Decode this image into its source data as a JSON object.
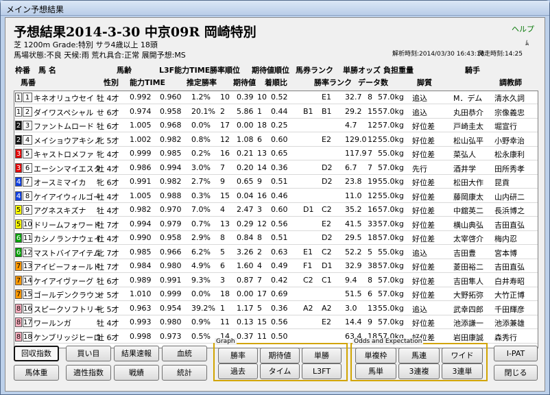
{
  "window": {
    "title": "メイン予想結果"
  },
  "header": {
    "title": "予想結果2014-3-30 中京09R 岡崎特別",
    "help": "ヘルプ",
    "pin": "ﾑ",
    "line1": "芝 1200m  Grade:特別  サラ4歳以上  18頭",
    "line2": "馬場状態:不良  天候:雨  荒れ具合:正常  展開予想:MS",
    "analysis": "解析時刻:2014/03/30 16:43:18",
    "post": "発走時刻:14:25"
  },
  "columns1": {
    "waku": "枠番",
    "uma": "馬 名",
    "age": "馬齢",
    "l3f": "L3F能力TIME",
    "win_rank": "勝率順位",
    "ev_rank": "期待値順位",
    "ticket_rank": "馬券ランク",
    "odds": "単勝オッズ",
    "weight": "負担重量",
    "jockey": "騎手"
  },
  "columns2": {
    "umaban": "馬番",
    "sex": "性別",
    "ability": "能力TIME",
    "pwin": "推定勝率",
    "ev": "期待値",
    "finish": "着順比",
    "rank": "勝率ランク",
    "data": "データ数",
    "style": "脚質",
    "trainer": "調教師"
  },
  "rows": [
    {
      "waku": "1",
      "umaban": "1",
      "name": "キネオリュウセイ",
      "sa": "牡 4才",
      "ability": "0.992",
      "l3f": "0.960",
      "pwin": "1.2%",
      "wr": "10",
      "ev": "0.39",
      "er": "10",
      "finish": "0.52",
      "r1": "",
      "r2": "E1",
      "odds": "32.7",
      "data": "8",
      "wt": "57.0kg",
      "style": "追込",
      "jockey": "M．デム",
      "trainer": "清水久詞"
    },
    {
      "waku": "1",
      "umaban": "2",
      "name": "ダイワスペシャル",
      "sa": "せ 6才",
      "ability": "0.974",
      "l3f": "0.958",
      "pwin": "20.1%",
      "wr": "2",
      "ev": "5.86",
      "er": "1",
      "finish": "0.44",
      "r1": "B1",
      "r2": "B1",
      "odds": "29.2",
      "data": "15",
      "wt": "57.0kg",
      "style": "追込",
      "jockey": "丸田恭介",
      "trainer": "宗像義忠"
    },
    {
      "waku": "2",
      "umaban": "3",
      "name": "ファントムロード",
      "sa": "牡 6才",
      "ability": "1.005",
      "l3f": "0.968",
      "pwin": "0.0%",
      "wr": "17",
      "ev": "0.00",
      "er": "18",
      "finish": "0.25",
      "r1": "",
      "r2": "",
      "odds": "4.7",
      "data": "12",
      "wt": "57.0kg",
      "style": "好位差",
      "jockey": "戸崎圭太",
      "trainer": "堀宣行"
    },
    {
      "waku": "2",
      "umaban": "4",
      "name": "メイショウアキシノ",
      "sa": "牝 5才",
      "ability": "1.002",
      "l3f": "0.982",
      "pwin": "0.8%",
      "wr": "12",
      "ev": "1.08",
      "er": "6",
      "finish": "0.60",
      "r1": "",
      "r2": "E2",
      "odds": "129.0",
      "data": "12",
      "wt": "55.0kg",
      "style": "好位差",
      "jockey": "松山弘平",
      "trainer": "小野幸治"
    },
    {
      "waku": "3",
      "umaban": "5",
      "name": "キャストロメファ",
      "sa": "牝 4才",
      "ability": "0.999",
      "l3f": "0.985",
      "pwin": "0.2%",
      "wr": "16",
      "ev": "0.21",
      "er": "13",
      "finish": "0.65",
      "r1": "",
      "r2": "",
      "odds": "117.9",
      "data": "7",
      "wt": "55.0kg",
      "style": "好位差",
      "jockey": "菜弘人",
      "trainer": "松永康利"
    },
    {
      "waku": "3",
      "umaban": "6",
      "name": "エーシンマイエスタ",
      "sa": "牡 4才",
      "ability": "0.986",
      "l3f": "0.994",
      "pwin": "3.0%",
      "wr": "7",
      "ev": "0.20",
      "er": "14",
      "finish": "0.36",
      "r1": "",
      "r2": "D2",
      "odds": "6.7",
      "data": "7",
      "wt": "57.0kg",
      "style": "先行",
      "jockey": "酒井学",
      "trainer": "田所秀孝"
    },
    {
      "waku": "4",
      "umaban": "7",
      "name": "オースミマイカ",
      "sa": "牝 6才",
      "ability": "0.991",
      "l3f": "0.982",
      "pwin": "2.7%",
      "wr": "9",
      "ev": "0.65",
      "er": "9",
      "finish": "0.51",
      "r1": "",
      "r2": "D2",
      "odds": "23.8",
      "data": "19",
      "wt": "55.0kg",
      "style": "好位差",
      "jockey": "松田大作",
      "trainer": "昆貢"
    },
    {
      "waku": "4",
      "umaban": "8",
      "name": "ケイアイウィルゴー",
      "sa": "牡 4才",
      "ability": "1.005",
      "l3f": "0.988",
      "pwin": "0.3%",
      "wr": "15",
      "ev": "0.04",
      "er": "16",
      "finish": "0.46",
      "r1": "",
      "r2": "",
      "odds": "11.0",
      "data": "12",
      "wt": "55.0kg",
      "style": "好位差",
      "jockey": "藤岡康太",
      "trainer": "山内研二"
    },
    {
      "waku": "5",
      "umaban": "9",
      "name": "アグネスキズナ",
      "sa": "牡 4才",
      "ability": "0.982",
      "l3f": "0.970",
      "pwin": "7.0%",
      "wr": "4",
      "ev": "2.47",
      "er": "3",
      "finish": "0.60",
      "r1": "D1",
      "r2": "C2",
      "odds": "35.2",
      "data": "16",
      "wt": "57.0kg",
      "style": "好位差",
      "jockey": "中舘英二",
      "trainer": "長浜博之"
    },
    {
      "waku": "5",
      "umaban": "10",
      "name": "ドリームフォワード",
      "sa": "牡 7才",
      "ability": "0.994",
      "l3f": "0.979",
      "pwin": "0.7%",
      "wr": "13",
      "ev": "0.29",
      "er": "12",
      "finish": "0.56",
      "r1": "",
      "r2": "E2",
      "odds": "41.5",
      "data": "33",
      "wt": "57.0kg",
      "style": "好位差",
      "jockey": "横山典弘",
      "trainer": "吉田直弘"
    },
    {
      "waku": "6",
      "umaban": "11",
      "name": "カシノランナウェイ",
      "sa": "牡 4才",
      "ability": "0.990",
      "l3f": "0.958",
      "pwin": "2.9%",
      "wr": "8",
      "ev": "0.84",
      "er": "8",
      "finish": "0.51",
      "r1": "",
      "r2": "D2",
      "odds": "29.5",
      "data": "18",
      "wt": "57.0kg",
      "style": "好位差",
      "jockey": "太宰啓介",
      "trainer": "梅内忍"
    },
    {
      "waku": "6",
      "umaban": "12",
      "name": "マストバイアイテム",
      "sa": "牝 7才",
      "ability": "0.985",
      "l3f": "0.966",
      "pwin": "6.2%",
      "wr": "5",
      "ev": "3.26",
      "er": "2",
      "finish": "0.63",
      "r1": "E1",
      "r2": "C2",
      "odds": "52.2",
      "data": "5",
      "wt": "55.0kg",
      "style": "追込",
      "jockey": "吉田豊",
      "trainer": "宮本博"
    },
    {
      "waku": "7",
      "umaban": "13",
      "name": "アイビーフォールド",
      "sa": "牡 7才",
      "ability": "0.984",
      "l3f": "0.980",
      "pwin": "4.9%",
      "wr": "6",
      "ev": "1.60",
      "er": "4",
      "finish": "0.49",
      "r1": "F1",
      "r2": "D1",
      "odds": "32.9",
      "data": "38",
      "wt": "57.0kg",
      "style": "好位差",
      "jockey": "菱田裕二",
      "trainer": "吉田直弘"
    },
    {
      "waku": "7",
      "umaban": "14",
      "name": "ケイアイヴァーグ",
      "sa": "牡 6才",
      "ability": "0.989",
      "l3f": "0.991",
      "pwin": "9.3%",
      "wr": "3",
      "ev": "0.87",
      "er": "7",
      "finish": "0.42",
      "r1": "C2",
      "r2": "C1",
      "odds": "9.4",
      "data": "8",
      "wt": "57.0kg",
      "style": "好位差",
      "jockey": "吉田隼人",
      "trainer": "白井寿昭"
    },
    {
      "waku": "7",
      "umaban": "15",
      "name": "ゴールデンクラウン",
      "sa": "せ 5才",
      "ability": "1.010",
      "l3f": "0.999",
      "pwin": "0.0%",
      "wr": "18",
      "ev": "0.00",
      "er": "17",
      "finish": "0.69",
      "r1": "",
      "r2": "",
      "odds": "51.5",
      "data": "6",
      "wt": "57.0kg",
      "style": "好位差",
      "jockey": "大野拓弥",
      "trainer": "大竹正博"
    },
    {
      "waku": "8",
      "umaban": "16",
      "name": "スピークソフトリー",
      "sa": "牝 5才",
      "ability": "0.963",
      "l3f": "0.954",
      "pwin": "39.2%",
      "wr": "1",
      "ev": "1.17",
      "er": "5",
      "finish": "0.36",
      "r1": "A2",
      "r2": "A2",
      "odds": "3.0",
      "data": "13",
      "wt": "55.0kg",
      "style": "追込",
      "jockey": "武幸四郎",
      "trainer": "千田輝彦"
    },
    {
      "waku": "8",
      "umaban": "17",
      "name": "ワールンガ",
      "sa": "牡 4才",
      "ability": "0.993",
      "l3f": "0.980",
      "pwin": "0.9%",
      "wr": "11",
      "ev": "0.13",
      "er": "15",
      "finish": "0.56",
      "r1": "",
      "r2": "E2",
      "odds": "14.4",
      "data": "9",
      "wt": "57.0kg",
      "style": "好位差",
      "jockey": "池添謙一",
      "trainer": "池添兼雄"
    },
    {
      "waku": "8",
      "umaban": "18",
      "name": "ケンブリッジヒーロ",
      "sa": "牡 6才",
      "ability": "0.998",
      "l3f": "0.973",
      "pwin": "0.5%",
      "wr": "14",
      "ev": "0.37",
      "er": "11",
      "finish": "0.50",
      "r1": "",
      "r2": "",
      "odds": "63.4",
      "data": "18",
      "wt": "57.0kg",
      "style": "好位差",
      "jockey": "岩田康誠",
      "trainer": "森秀行"
    }
  ],
  "waku_colors": {
    "1": "#ffffff",
    "2": "#111111",
    "3": "#e00000",
    "4": "#1040e0",
    "5": "#ffff00",
    "6": "#00a000",
    "7": "#ff9900",
    "8": "#ffb0c0"
  },
  "buttons": {
    "kaishu": "回収指数",
    "kaime": "買い目",
    "kekka": "結果速報",
    "ketto": "血統",
    "bataiju": "馬体重",
    "tekisei": "適性指数",
    "senseki": "戦績",
    "tokei": "統計",
    "ipat": "I-PAT",
    "close": "閉じる"
  },
  "graph": {
    "title": "Graph",
    "shoritsu": "勝率",
    "kitaichi": "期待値",
    "tansho": "単勝",
    "kako": "過去",
    "time": "タイム",
    "l3ft": "L3FT"
  },
  "odds": {
    "title": "Odds and Expectation",
    "fukusho": "単複枠",
    "umaren": "馬連",
    "wide": "ワイド",
    "umatan": "馬単",
    "sanrenpuku": "3連複",
    "sanrentan": "3連単"
  }
}
